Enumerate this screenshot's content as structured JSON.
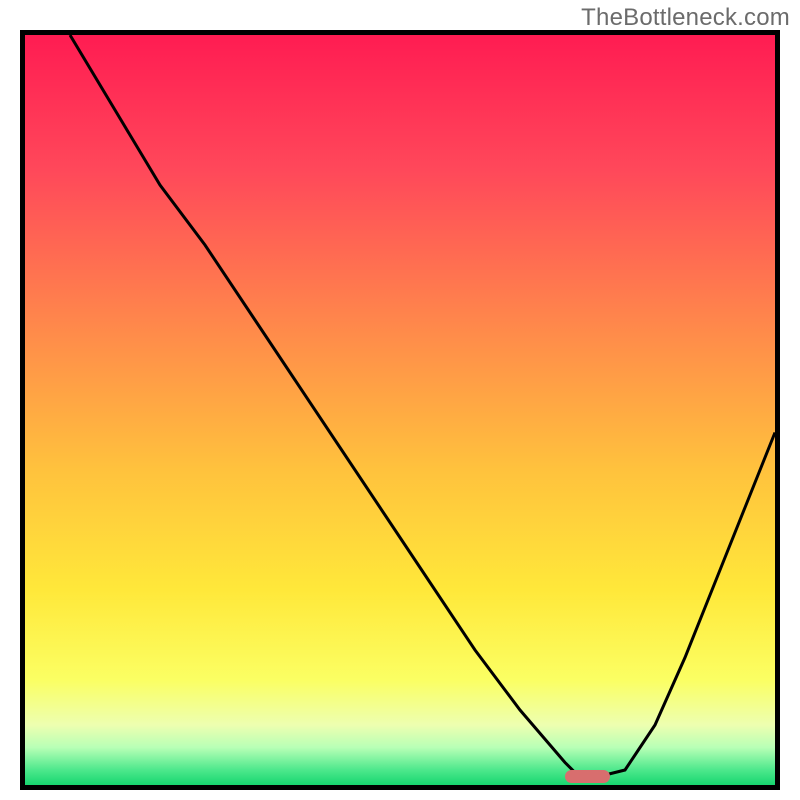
{
  "watermark": "TheBottleneck.com",
  "chart_data": {
    "type": "line",
    "title": "",
    "xlabel": "",
    "ylabel": "",
    "xlim": [
      0,
      100
    ],
    "ylim": [
      0,
      100
    ],
    "grid": false,
    "legend": false,
    "series": [
      {
        "name": "curve",
        "x": [
          6,
          12,
          18,
          24,
          30,
          36,
          42,
          48,
          54,
          60,
          66,
          72,
          74,
          76,
          80,
          84,
          88,
          92,
          96,
          100
        ],
        "y": [
          100,
          90,
          80,
          72,
          63,
          54,
          45,
          36,
          27,
          18,
          10,
          3,
          1,
          1,
          2,
          8,
          17,
          27,
          37,
          47
        ],
        "color": "#000000"
      }
    ],
    "marker": {
      "x_range": [
        72,
        78
      ],
      "y": 1,
      "color": "#d86e6e"
    },
    "gradient_stops": [
      {
        "pct": 0,
        "color": "#ff1c52"
      },
      {
        "pct": 18,
        "color": "#ff485a"
      },
      {
        "pct": 40,
        "color": "#ff8c4a"
      },
      {
        "pct": 58,
        "color": "#ffc23d"
      },
      {
        "pct": 74,
        "color": "#ffe83a"
      },
      {
        "pct": 86,
        "color": "#fbff63"
      },
      {
        "pct": 92,
        "color": "#edffb0"
      },
      {
        "pct": 95,
        "color": "#b8ffb6"
      },
      {
        "pct": 98,
        "color": "#4de88c"
      },
      {
        "pct": 100,
        "color": "#17d66f"
      }
    ]
  }
}
